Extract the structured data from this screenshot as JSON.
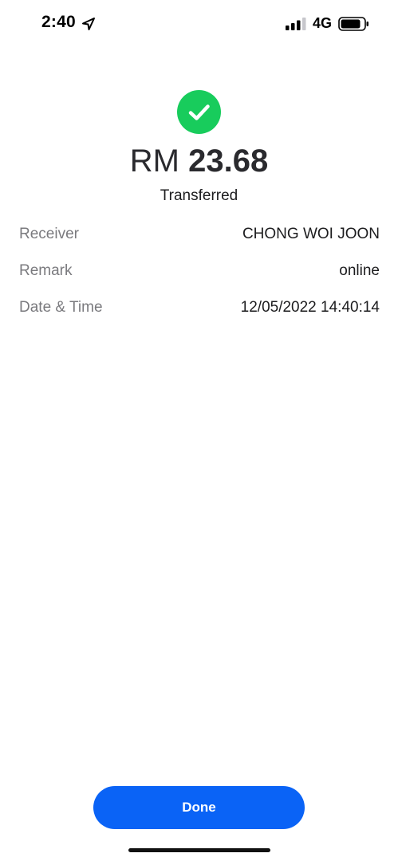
{
  "status_bar": {
    "time": "2:40",
    "network": "4G",
    "icons": [
      "location-arrow-icon",
      "signal-icon",
      "battery-icon"
    ]
  },
  "receipt": {
    "currency": "RM",
    "amount": "23.68",
    "status": "Transferred",
    "success_icon": "checkmark-icon",
    "accent_color": "#18cc5c"
  },
  "details": [
    {
      "label": "Receiver",
      "value": "CHONG WOI JOON"
    },
    {
      "label": "Remark",
      "value": "online"
    },
    {
      "label": "Date & Time",
      "value": "12/05/2022 14:40:14"
    }
  ],
  "actions": {
    "done_label": "Done",
    "button_color": "#0a63f6"
  }
}
